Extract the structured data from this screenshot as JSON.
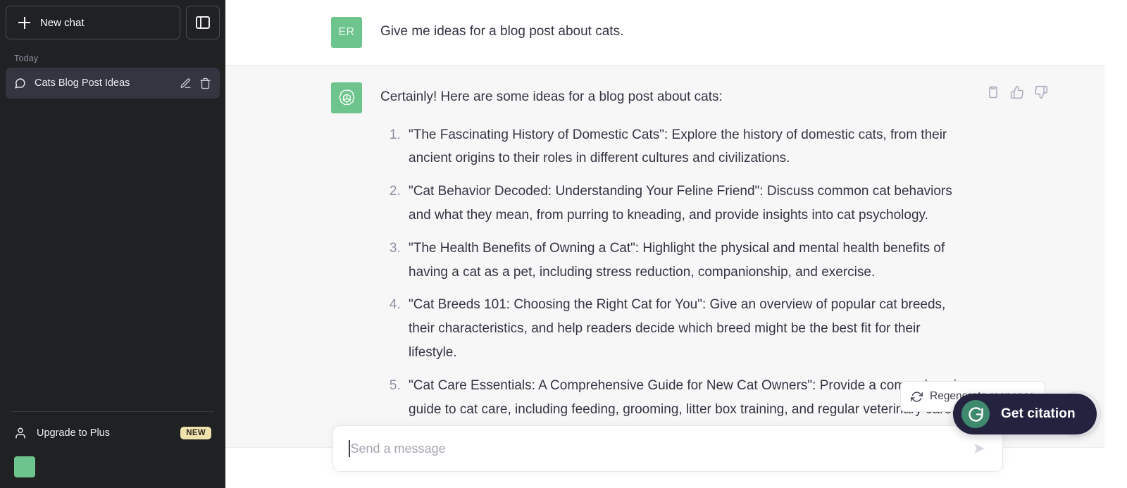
{
  "sidebar": {
    "new_chat_label": "New chat",
    "new_chat_icon": "plus-icon",
    "toggle_icon": "sidebar-panel-icon",
    "section_label": "Today",
    "chats": [
      {
        "title": "Cats Blog Post Ideas",
        "icon": "message-bubble-icon",
        "edit_icon": "pencil-icon",
        "delete_icon": "trash-icon",
        "active": true
      }
    ],
    "upgrade": {
      "label": "Upgrade to Plus",
      "icon": "person-icon",
      "badge": "NEW",
      "badge_color": "#f0e2ad"
    },
    "user_avatar_color": "#6dc48c",
    "background_color": "#202123"
  },
  "conversation": {
    "messages": [
      {
        "role": "user",
        "avatar_initials": "ER",
        "avatar_color": "#6dc48c",
        "text": "Give me ideas for a blog post about cats."
      },
      {
        "role": "assistant",
        "avatar_icon": "openai-logo-icon",
        "avatar_color": "#6dc48c",
        "intro": "Certainly! Here are some ideas for a blog post about cats:",
        "list": [
          "\"The Fascinating History of Domestic Cats\": Explore the history of domestic cats, from their ancient origins to their roles in different cultures and civilizations.",
          "\"Cat Behavior Decoded: Understanding Your Feline Friend\": Discuss common cat behaviors and what they mean, from purring to kneading, and provide insights into cat psychology.",
          "\"The Health Benefits of Owning a Cat\": Highlight the physical and mental health benefits of having a cat as a pet, including stress reduction, companionship, and exercise.",
          "\"Cat Breeds 101: Choosing the Right Cat for You\": Give an overview of popular cat breeds, their characteristics, and help readers decide which breed might be the best fit for their lifestyle.",
          "\"Cat Care Essentials: A Comprehensive Guide for New Cat Owners\": Provide a comprehensive guide to cat care, including feeding, grooming, litter box training, and regular veterinary care."
        ],
        "actions": [
          {
            "name": "copy-icon",
            "label": "Copy"
          },
          {
            "name": "thumbs-up-icon",
            "label": "Good response"
          },
          {
            "name": "thumbs-down-icon",
            "label": "Bad response"
          }
        ]
      }
    ]
  },
  "regenerate": {
    "label": "Regenerate response",
    "icon": "refresh-icon"
  },
  "citation_widget": {
    "label": "Get citation",
    "logo_icon": "g-citation-logo-icon",
    "pill_color": "#232340",
    "logo_color": "#3f8a6e"
  },
  "composer": {
    "placeholder": "Send a message",
    "value": "",
    "send_icon": "send-arrow-icon"
  }
}
